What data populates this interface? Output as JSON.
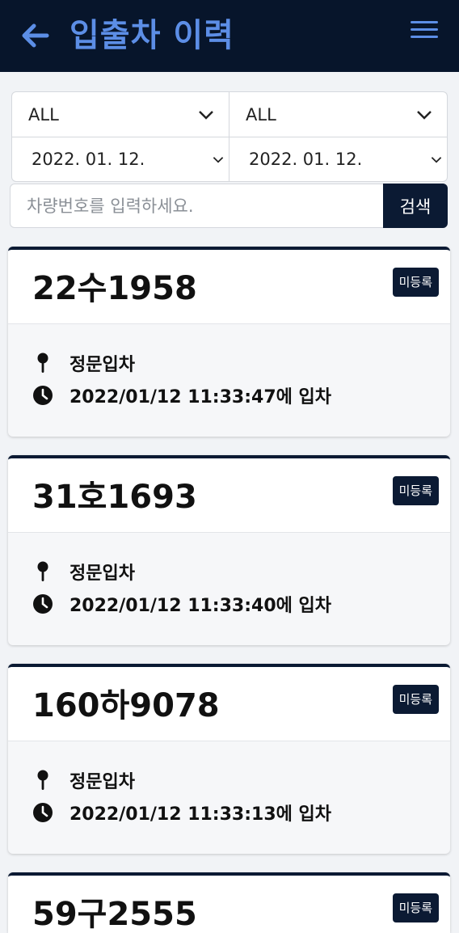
{
  "header": {
    "title": "입출차 이력"
  },
  "filters": {
    "select1": "ALL",
    "select2": "ALL",
    "date_from": "2022. 01. 12.",
    "date_to": "2022. 01. 12.",
    "search_placeholder": "차량번호를 입력하세요.",
    "search_button": "검색"
  },
  "records": [
    {
      "plate": "22수1958",
      "badge": "미등록",
      "gate": "정문입차",
      "time": "2022/01/12 11:33:47에 입차"
    },
    {
      "plate": "31호1693",
      "badge": "미등록",
      "gate": "정문입차",
      "time": "2022/01/12 11:33:40에 입차"
    },
    {
      "plate": "160하9078",
      "badge": "미등록",
      "gate": "정문입차",
      "time": "2022/01/12 11:33:13에 입차"
    },
    {
      "plate": "59구2555",
      "badge": "미등록",
      "gate": "",
      "time": ""
    }
  ],
  "colors": {
    "header_bg": "#07152b",
    "accent": "#5c8ee6",
    "badge_bg": "#0b1a33"
  }
}
